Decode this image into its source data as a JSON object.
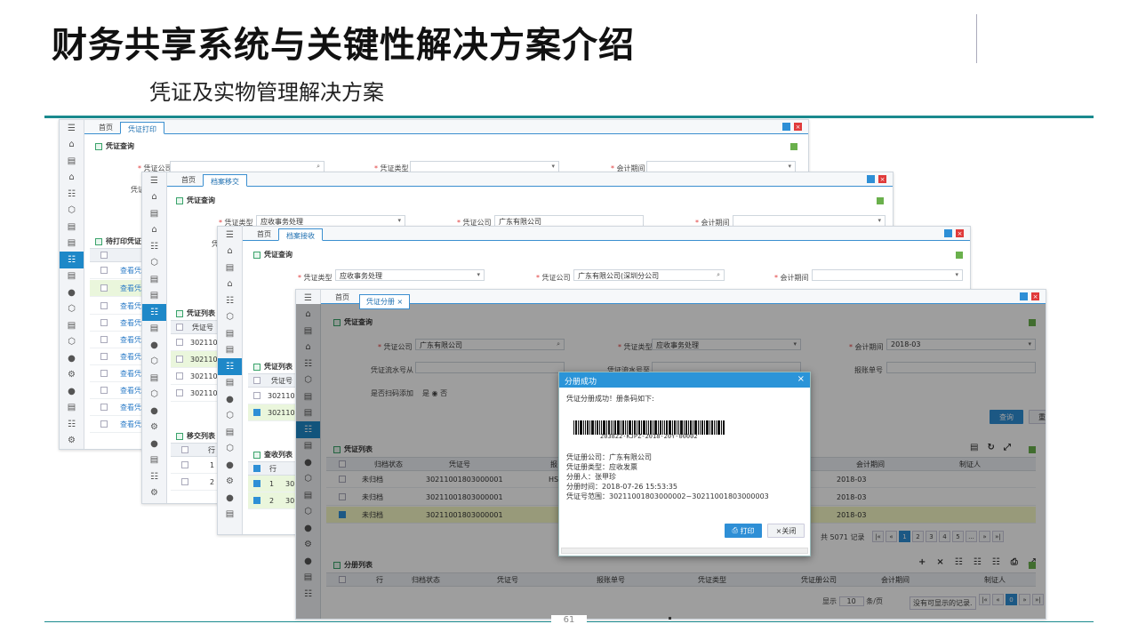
{
  "slide": {
    "title": "财务共享系统与关键性解决方案介绍",
    "subtitle": "凭证及实物管理解决方案",
    "page_number": "61"
  },
  "icons": {
    "menu": "☰",
    "home": "⌂",
    "doc": "▤",
    "bank": "⌂",
    "list": "☷",
    "box": "⬡",
    "user": "●",
    "gear": "⚙",
    "search": "⌕",
    "dropdown": "▾",
    "close": "×",
    "printer": "⎙",
    "refresh": "↻",
    "expand": "⤢",
    "plus": "+",
    "minus": "×"
  },
  "w1": {
    "tabs": [
      "首页",
      "凭证打印"
    ],
    "query_title": "凭证查询",
    "f1": "凭证公司",
    "f2": "凭证类型",
    "f3": "会计期间",
    "f4": "凭证",
    "list_title": "待打印凭证",
    "link": "查看凭证"
  },
  "w2": {
    "tabs": [
      "首页",
      "档案移交"
    ],
    "query_title": "凭证查询",
    "f1": "凭证类型",
    "f1v": "应收事务处理",
    "f2": "凭证公司",
    "f2v": "广东有限公司",
    "f3": "会计期间",
    "f4": "凭证",
    "list_title": "凭证列表",
    "col": "凭证号",
    "rows": [
      "3021100",
      "3021100",
      "3021100",
      "3021100"
    ],
    "list2_title": "移交列表",
    "col2": "行",
    "r1": "1",
    "r2": "2"
  },
  "w3": {
    "tabs": [
      "首页",
      "档案接收"
    ],
    "query_title": "凭证查询",
    "f1": "凭证类型",
    "f1v": "应收事务处理",
    "f2": "凭证公司",
    "f2v": "广东有限公司(深圳分公司",
    "f3": "会计期间",
    "list_title": "凭证列表",
    "col": "凭证号",
    "rows": [
      "3021100",
      "3021100"
    ],
    "list2_title": "查收列表",
    "col2": "行",
    "r1": "1",
    "r2": "2",
    "r1b": "30",
    "r2b": "30"
  },
  "w4": {
    "tabs": [
      "首页",
      "凭证分册"
    ],
    "query_title": "凭证查询",
    "f_company": "凭证公司",
    "f_company_v": "广东有限公司",
    "f_type": "凭证类型",
    "f_type_v": "应收事务处理",
    "f_period": "会计期间",
    "f_period_v": "2018-03",
    "f_from": "凭证流水号从",
    "f_to": "凭证流水号至",
    "f_bill": "报账单号",
    "f_scan": "是否扫码添加",
    "yes": "是",
    "no": "否",
    "query_btn": "查询",
    "reset_btn": "重置",
    "list_title": "凭证列表",
    "cols": [
      "归档状态",
      "凭证号",
      "报",
      "会计期间",
      "制证人"
    ],
    "rows": [
      {
        "status": "未归档",
        "no": "30211001803000001",
        "bill": "HSD56410",
        "period": "2018-03"
      },
      {
        "status": "未归档",
        "no": "30211001803000001",
        "bill": "",
        "period": "2018-03"
      },
      {
        "status": "未归档",
        "no": "30211001803000001",
        "bill": "",
        "period": "2018-03"
      }
    ],
    "total": "共 5071 记录",
    "pages": [
      "1",
      "2",
      "3",
      "4",
      "5",
      "..."
    ],
    "split_title": "分册列表",
    "split_cols": [
      "行",
      "归档状态",
      "凭证号",
      "报账单号",
      "凭证类型",
      "凭证册公司",
      "会计期间",
      "制证人"
    ],
    "show": "显示",
    "per": "10",
    "perunit": "条/页",
    "empty": "没有可显示的记录.",
    "cur": "0"
  },
  "dialog": {
    "title": "分册成功",
    "msg": "凭证分册成功！册条码如下:",
    "barcode_text": "203822-KJPZ-2018-20Y-00002",
    "lines": [
      "凭证册公司：广东有限公司",
      "凭证册类型：应收发票",
      "分册人：张甲珍",
      "分册时间：2018-07-26 15:53:35",
      "凭证号范围：30211001803000002~30211001803000003"
    ],
    "print_btn": "打印",
    "close_btn": "关闭"
  }
}
